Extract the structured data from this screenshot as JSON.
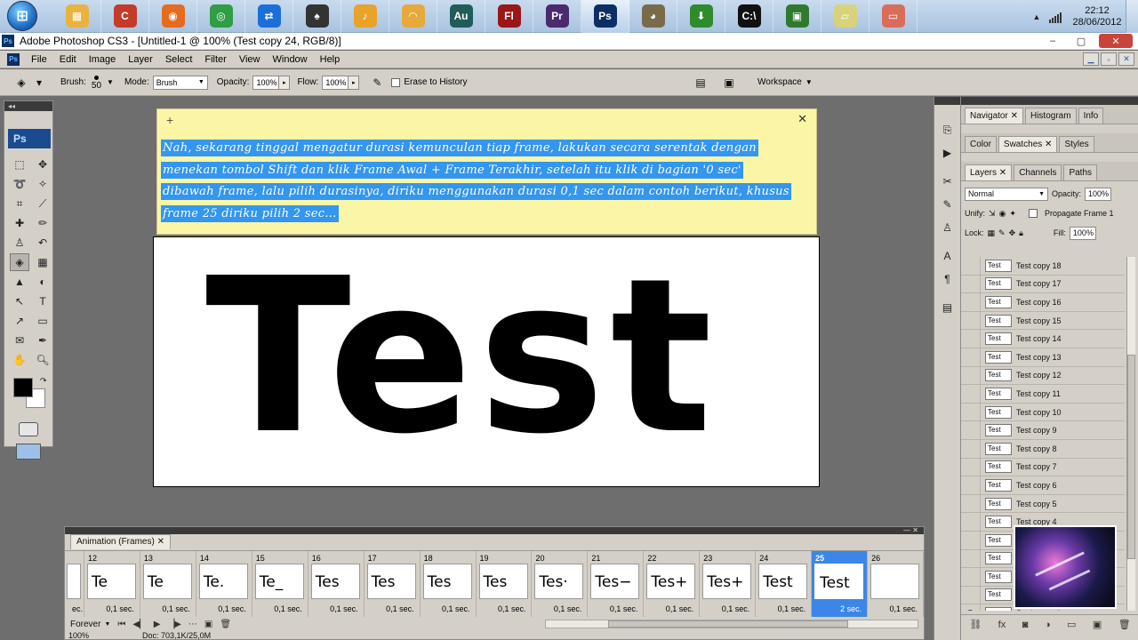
{
  "taskbar": {
    "start_label": "⊞",
    "apps": [
      {
        "name": "file-manager-icon",
        "glyph": "▦",
        "color": "#e8b33e"
      },
      {
        "name": "ccleaner-icon",
        "glyph": "C",
        "color": "#c53a2b"
      },
      {
        "name": "firefox-icon",
        "glyph": "◉",
        "color": "#e56b1f"
      },
      {
        "name": "chrome-icon",
        "glyph": "◎",
        "color": "#2f9e44"
      },
      {
        "name": "teamviewer-icon",
        "glyph": "⇄",
        "color": "#1c6fd8"
      },
      {
        "name": "guitar-icon",
        "glyph": "♠",
        "color": "#333333"
      },
      {
        "name": "flstudio-icon",
        "glyph": "♪",
        "color": "#e9a22a"
      },
      {
        "name": "headphones-icon",
        "glyph": "◠",
        "color": "#e6a93a"
      },
      {
        "name": "audition-icon",
        "glyph": "Au",
        "color": "#1f5c5a"
      },
      {
        "name": "flash-icon",
        "glyph": "Fl",
        "color": "#9b1616"
      },
      {
        "name": "premiere-icon",
        "glyph": "Pr",
        "color": "#4b2a6e"
      },
      {
        "name": "photoshop-icon",
        "glyph": "Ps",
        "color": "#0c2f63"
      },
      {
        "name": "gimp-icon",
        "glyph": "◕",
        "color": "#7a6a4a"
      },
      {
        "name": "idm-icon",
        "glyph": "⬇",
        "color": "#2e8b2e"
      },
      {
        "name": "cmd-icon",
        "glyph": "C:\\",
        "color": "#111111"
      },
      {
        "name": "monitor-icon",
        "glyph": "▣",
        "color": "#2f7a2f"
      },
      {
        "name": "folder-notes-icon",
        "glyph": "▱",
        "color": "#d9d27a"
      },
      {
        "name": "window-icon",
        "glyph": "▭",
        "color": "#d86d5a"
      }
    ],
    "time": "22:12",
    "date": "28/06/2012"
  },
  "window": {
    "title": "Adobe Photoshop CS3 - [Untitled-1 @ 100% (Test copy 24, RGB/8)]",
    "minimize": "‒",
    "maximize": "▢",
    "close": "✕"
  },
  "menu": [
    "File",
    "Edit",
    "Image",
    "Layer",
    "Select",
    "Filter",
    "View",
    "Window",
    "Help"
  ],
  "options": {
    "brush_label": "Brush:",
    "brush_size": "50",
    "mode_label": "Mode:",
    "mode_value": "Brush",
    "opacity_label": "Opacity:",
    "opacity_value": "100%",
    "flow_label": "Flow:",
    "flow_value": "100%",
    "erase_history": "Erase to History",
    "workspace": "Workspace"
  },
  "tools_logo": "Ps",
  "note": {
    "plus": "+",
    "close": "✕",
    "lines": [
      "Nah, sekarang tinggal mengatur durasi kemunculan tiap frame, lakukan secara serentak dengan",
      "menekan tombol Shift dan klik Frame Awal + Frame Terakhir, setelah itu klik di bagian '0 sec'",
      "dibawah frame, lalu pilih durasinya, diriku menggunakan durasi 0,1 sec dalam contoh berikut, khusus",
      "frame 25 diriku pilih 2 sec..."
    ]
  },
  "canvas_text": "Test",
  "animation": {
    "tab": "Animation (Frames)",
    "first_partial_dur": "ec.",
    "frames": [
      {
        "num": "12",
        "thumb": "Te",
        "dur": "0,1 sec."
      },
      {
        "num": "13",
        "thumb": "Te",
        "dur": "0,1 sec."
      },
      {
        "num": "14",
        "thumb": "Te.",
        "dur": "0,1 sec."
      },
      {
        "num": "15",
        "thumb": "Te_",
        "dur": "0,1 sec."
      },
      {
        "num": "16",
        "thumb": "Tes",
        "dur": "0,1 sec."
      },
      {
        "num": "17",
        "thumb": "Tes",
        "dur": "0,1 sec."
      },
      {
        "num": "18",
        "thumb": "Tes",
        "dur": "0,1 sec."
      },
      {
        "num": "19",
        "thumb": "Tes",
        "dur": "0,1 sec."
      },
      {
        "num": "20",
        "thumb": "Tes·",
        "dur": "0,1 sec."
      },
      {
        "num": "21",
        "thumb": "Tes−",
        "dur": "0,1 sec."
      },
      {
        "num": "22",
        "thumb": "Tes+",
        "dur": "0,1 sec."
      },
      {
        "num": "23",
        "thumb": "Tes+",
        "dur": "0,1 sec."
      },
      {
        "num": "24",
        "thumb": "Test",
        "dur": "0,1 sec."
      },
      {
        "num": "25",
        "thumb": "Test",
        "dur": "2 sec."
      },
      {
        "num": "26",
        "thumb": "",
        "dur": "0,1 sec."
      }
    ],
    "loop": "Forever",
    "zoom": "100%",
    "doc": "Doc: 703,1K/25,0M"
  },
  "panels": {
    "group1": [
      "Navigator",
      "Histogram",
      "Info"
    ],
    "group2": [
      "Color",
      "Swatches",
      "Styles"
    ],
    "group3": [
      "Layers",
      "Channels",
      "Paths"
    ],
    "blend_mode": "Normal",
    "opacity_label": "Opacity:",
    "opacity_value": "100%",
    "unify_label": "Unify:",
    "propagate_label": "Propagate Frame 1",
    "lock_label": "Lock:",
    "fill_label": "Fill:",
    "fill_value": "100%",
    "layers": [
      "Test copy 18",
      "Test copy 17",
      "Test copy 16",
      "Test copy 15",
      "Test copy 14",
      "Test copy 13",
      "Test copy 12",
      "Test copy 11",
      "Test copy 10",
      "Test copy 9",
      "Test copy 8",
      "Test copy 7",
      "Test copy 6",
      "Test copy 5",
      "Test copy 4",
      "",
      "",
      "",
      ""
    ],
    "background_layer": "Background"
  }
}
